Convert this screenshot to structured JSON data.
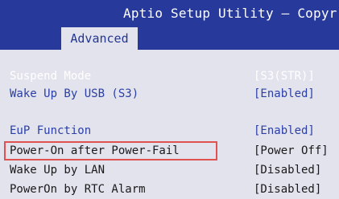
{
  "header": {
    "title": "Aptio Setup Utility – Copyr",
    "active_tab": "Advanced"
  },
  "menu": {
    "items": [
      {
        "label": "Suspend Mode",
        "value": "[S3(STR)]"
      },
      {
        "label": "Wake Up By USB (S3)",
        "value": "[Enabled]"
      },
      {
        "label": "EuP Function",
        "value": "[Enabled]"
      },
      {
        "label": "Power-On after Power-Fail",
        "value": "[Power Off]"
      },
      {
        "label": "Wake Up by LAN",
        "value": "[Disabled]"
      },
      {
        "label": "PowerOn by RTC Alarm",
        "value": "[Disabled]"
      }
    ]
  },
  "colors": {
    "header_bg": "#27399a",
    "body_bg": "#e2e3ed",
    "selected_text": "#ffffff",
    "item_text_blue": "#2b3fa6",
    "item_text_dark": "#1a1a1a",
    "highlight_border": "#e0524f"
  }
}
